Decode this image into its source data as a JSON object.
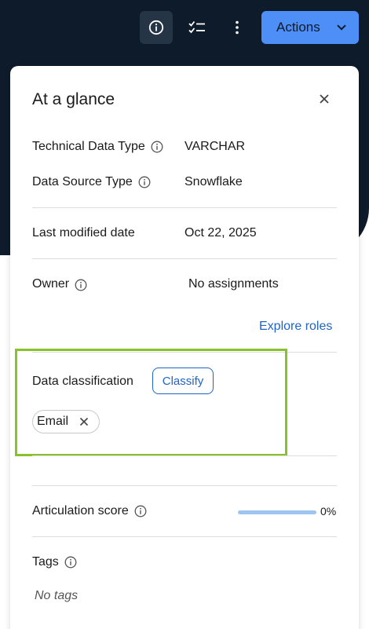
{
  "header": {
    "actions_label": "Actions",
    "icons": [
      "info-icon",
      "checklist-icon",
      "more-vertical-icon",
      "chevron-down-icon"
    ]
  },
  "panel": {
    "title": "At a glance",
    "technical_data_type": {
      "label": "Technical Data Type",
      "value": "VARCHAR"
    },
    "data_source_type": {
      "label": "Data Source Type",
      "value": "Snowflake"
    },
    "last_modified": {
      "label": "Last modified date",
      "value": "Oct 22, 2025"
    },
    "owner": {
      "label": "Owner",
      "value": "No assignments"
    },
    "explore_roles": "Explore roles",
    "classification": {
      "label": "Data classification",
      "classify_label": "Classify",
      "chips": [
        "Email"
      ]
    },
    "articulation": {
      "label": "Articulation score",
      "value": "0%",
      "progress": 0
    },
    "tags": {
      "label": "Tags",
      "empty_text": "No tags"
    }
  },
  "colors": {
    "header_bg": "#0e1b2a",
    "accent": "#4d8ef7",
    "link": "#1f64c8",
    "highlight": "#88c12a"
  }
}
